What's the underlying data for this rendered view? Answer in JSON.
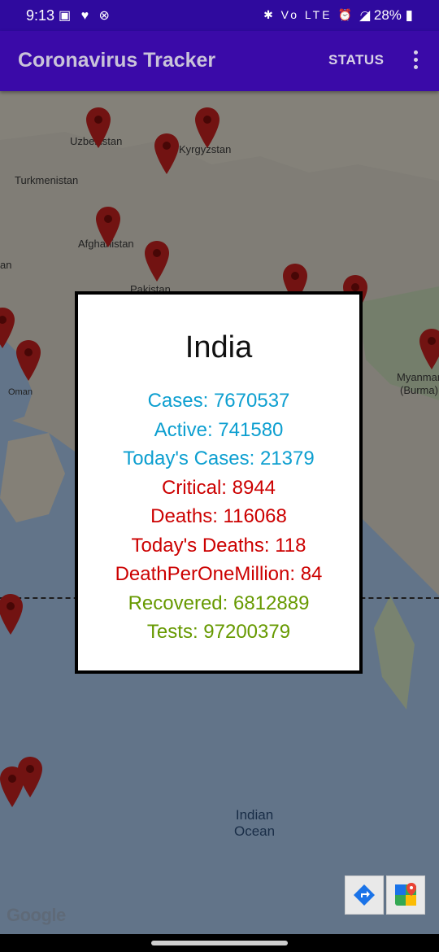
{
  "status_bar": {
    "time": "9:13",
    "left_icons": "▣ ♥ ⊗",
    "right_icons": "✱ Vo LTE ⏰ ◠",
    "battery": "◢ 28% ▮"
  },
  "app_bar": {
    "title": "Coronavirus Tracker",
    "status_label": "STATUS"
  },
  "map": {
    "labels": {
      "uzbekistan": "Uzbekistan",
      "kyrgyzstan": "Kyrgyzstan",
      "turkmenistan": "Turkmenistan",
      "afghanistan": "Afghanistan",
      "iran": "an",
      "pakistan": "Pakistan",
      "oman": "Oman",
      "myanmar_1": "Myanmar",
      "myanmar_2": "(Burma)",
      "ocean_1": "Indian",
      "ocean_2": "Ocean"
    },
    "google_logo": "Google",
    "pin_color": "#c5221f"
  },
  "dialog": {
    "country": "India",
    "stats": [
      {
        "text": "Cases: 7670537",
        "color": "#0d9fd0"
      },
      {
        "text": "Active: 741580",
        "color": "#0d9fd0"
      },
      {
        "text": "Today's Cases: 21379",
        "color": "#0d9fd0"
      },
      {
        "text": "Critical: 8944",
        "color": "#cc0000"
      },
      {
        "text": "Deaths: 116068",
        "color": "#cc0000"
      },
      {
        "text": "Today's Deaths: 118",
        "color": "#cc0000"
      },
      {
        "text": "DeathPerOneMillion: 84",
        "color": "#cc0000"
      },
      {
        "text": "Recovered: 6812889",
        "color": "#669900"
      },
      {
        "text": "Tests: 97200379",
        "color": "#669900"
      }
    ]
  }
}
